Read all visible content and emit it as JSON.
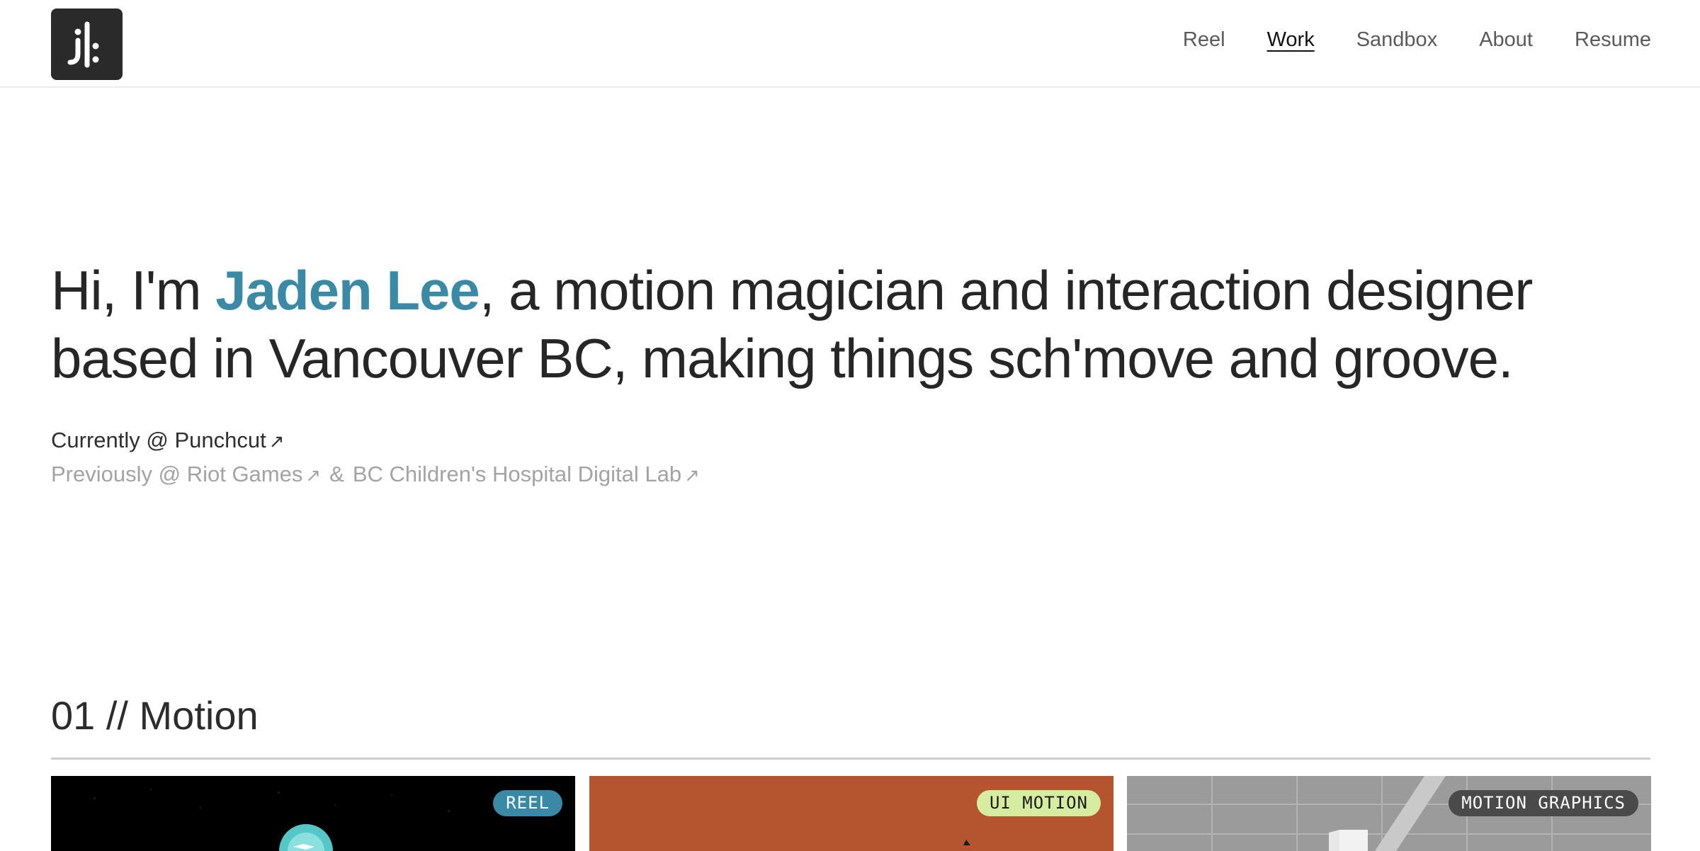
{
  "header": {
    "logo_alt": "jl",
    "nav": [
      {
        "label": "Reel",
        "active": false
      },
      {
        "label": "Work",
        "active": true
      },
      {
        "label": "Sandbox",
        "active": false
      },
      {
        "label": "About",
        "active": false
      },
      {
        "label": "Resume",
        "active": false
      }
    ]
  },
  "hero": {
    "intro_pre": "Hi, I'm ",
    "name": "Jaden Lee",
    "intro_post": ", a motion magician and interaction designer based in Vancouver BC, making things sch'move and groove.",
    "currently_prefix": "Currently @ ",
    "currently_company": "Punchcut",
    "previously_prefix": "Previously @ ",
    "previously_company_1": "Riot Games",
    "amp": "&",
    "previously_company_2": "BC Children's Hospital Digital Lab",
    "arrow": "↗"
  },
  "section": {
    "title": "01 // Motion"
  },
  "cards": [
    {
      "badge": "REEL",
      "color": "#000000"
    },
    {
      "badge": "UI MOTION",
      "color": "#b5552f"
    },
    {
      "badge": "MOTION GRAPHICS",
      "color": "#9b9b9b"
    }
  ],
  "colors": {
    "accent": "#3b8aa5",
    "text": "#262626",
    "muted": "#a3a3a3"
  }
}
